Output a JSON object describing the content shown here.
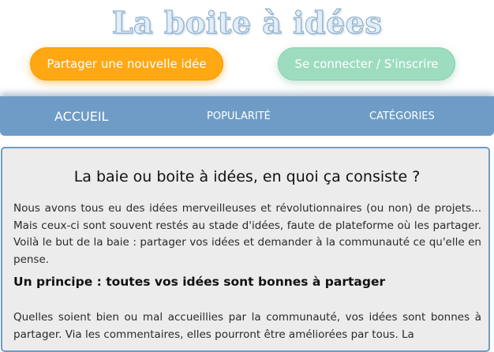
{
  "header": {
    "brand": "La boite à idées",
    "share_button": "Partager une nouvelle idée",
    "login_button": "Se connecter / S'inscrire"
  },
  "nav": {
    "items": [
      "ACCUEIL",
      "POPULARITÉ",
      "CATÉGORIES"
    ]
  },
  "main": {
    "title": "La baie ou boite à idées, en quoi ça consiste ?",
    "intro": "Nous avons tous eu des idées merveilleuses et révolutionnaires (ou non) de projets... Mais ceux-ci sont souvent restés au stade d'idées, faute de plateforme où les partager. Voilà le but de la baie : partager vos idées et demander à la communauté ce qu'elle en pense.",
    "section_title": "Un principe : toutes vos idées sont bonnes à partager",
    "section_text": "Quelles soient bien ou mal accueillies par la communauté, vos idées sont bonnes à partager. Via les commentaires, elles pourront être améliorées par tous. La"
  },
  "colors": {
    "share_button": "#ffa814",
    "login_button": "#9edcc0",
    "nav_bar": "#6e9cc6",
    "card_background": "#ececed"
  }
}
